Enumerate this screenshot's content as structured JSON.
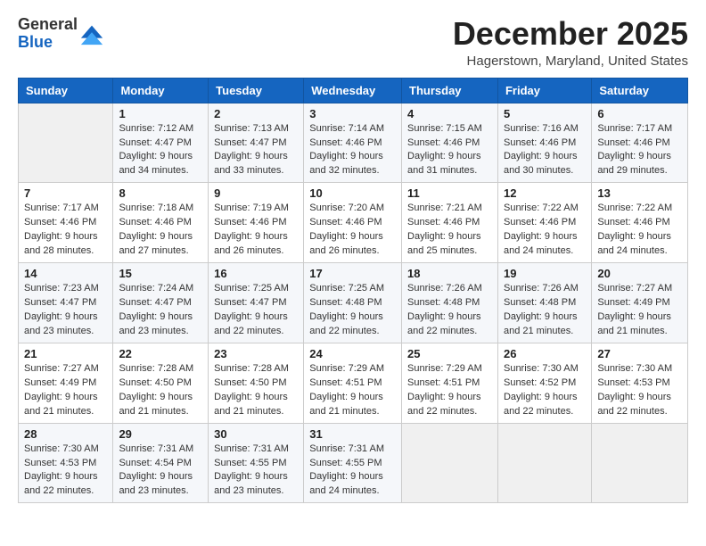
{
  "header": {
    "logo_general": "General",
    "logo_blue": "Blue",
    "month_title": "December 2025",
    "location": "Hagerstown, Maryland, United States"
  },
  "days_of_week": [
    "Sunday",
    "Monday",
    "Tuesday",
    "Wednesday",
    "Thursday",
    "Friday",
    "Saturday"
  ],
  "weeks": [
    [
      {
        "day": "",
        "sunrise": "",
        "sunset": "",
        "daylight": ""
      },
      {
        "day": "1",
        "sunrise": "Sunrise: 7:12 AM",
        "sunset": "Sunset: 4:47 PM",
        "daylight": "Daylight: 9 hours and 34 minutes."
      },
      {
        "day": "2",
        "sunrise": "Sunrise: 7:13 AM",
        "sunset": "Sunset: 4:47 PM",
        "daylight": "Daylight: 9 hours and 33 minutes."
      },
      {
        "day": "3",
        "sunrise": "Sunrise: 7:14 AM",
        "sunset": "Sunset: 4:46 PM",
        "daylight": "Daylight: 9 hours and 32 minutes."
      },
      {
        "day": "4",
        "sunrise": "Sunrise: 7:15 AM",
        "sunset": "Sunset: 4:46 PM",
        "daylight": "Daylight: 9 hours and 31 minutes."
      },
      {
        "day": "5",
        "sunrise": "Sunrise: 7:16 AM",
        "sunset": "Sunset: 4:46 PM",
        "daylight": "Daylight: 9 hours and 30 minutes."
      },
      {
        "day": "6",
        "sunrise": "Sunrise: 7:17 AM",
        "sunset": "Sunset: 4:46 PM",
        "daylight": "Daylight: 9 hours and 29 minutes."
      }
    ],
    [
      {
        "day": "7",
        "sunrise": "Sunrise: 7:17 AM",
        "sunset": "Sunset: 4:46 PM",
        "daylight": "Daylight: 9 hours and 28 minutes."
      },
      {
        "day": "8",
        "sunrise": "Sunrise: 7:18 AM",
        "sunset": "Sunset: 4:46 PM",
        "daylight": "Daylight: 9 hours and 27 minutes."
      },
      {
        "day": "9",
        "sunrise": "Sunrise: 7:19 AM",
        "sunset": "Sunset: 4:46 PM",
        "daylight": "Daylight: 9 hours and 26 minutes."
      },
      {
        "day": "10",
        "sunrise": "Sunrise: 7:20 AM",
        "sunset": "Sunset: 4:46 PM",
        "daylight": "Daylight: 9 hours and 26 minutes."
      },
      {
        "day": "11",
        "sunrise": "Sunrise: 7:21 AM",
        "sunset": "Sunset: 4:46 PM",
        "daylight": "Daylight: 9 hours and 25 minutes."
      },
      {
        "day": "12",
        "sunrise": "Sunrise: 7:22 AM",
        "sunset": "Sunset: 4:46 PM",
        "daylight": "Daylight: 9 hours and 24 minutes."
      },
      {
        "day": "13",
        "sunrise": "Sunrise: 7:22 AM",
        "sunset": "Sunset: 4:46 PM",
        "daylight": "Daylight: 9 hours and 24 minutes."
      }
    ],
    [
      {
        "day": "14",
        "sunrise": "Sunrise: 7:23 AM",
        "sunset": "Sunset: 4:47 PM",
        "daylight": "Daylight: 9 hours and 23 minutes."
      },
      {
        "day": "15",
        "sunrise": "Sunrise: 7:24 AM",
        "sunset": "Sunset: 4:47 PM",
        "daylight": "Daylight: 9 hours and 23 minutes."
      },
      {
        "day": "16",
        "sunrise": "Sunrise: 7:25 AM",
        "sunset": "Sunset: 4:47 PM",
        "daylight": "Daylight: 9 hours and 22 minutes."
      },
      {
        "day": "17",
        "sunrise": "Sunrise: 7:25 AM",
        "sunset": "Sunset: 4:48 PM",
        "daylight": "Daylight: 9 hours and 22 minutes."
      },
      {
        "day": "18",
        "sunrise": "Sunrise: 7:26 AM",
        "sunset": "Sunset: 4:48 PM",
        "daylight": "Daylight: 9 hours and 22 minutes."
      },
      {
        "day": "19",
        "sunrise": "Sunrise: 7:26 AM",
        "sunset": "Sunset: 4:48 PM",
        "daylight": "Daylight: 9 hours and 21 minutes."
      },
      {
        "day": "20",
        "sunrise": "Sunrise: 7:27 AM",
        "sunset": "Sunset: 4:49 PM",
        "daylight": "Daylight: 9 hours and 21 minutes."
      }
    ],
    [
      {
        "day": "21",
        "sunrise": "Sunrise: 7:27 AM",
        "sunset": "Sunset: 4:49 PM",
        "daylight": "Daylight: 9 hours and 21 minutes."
      },
      {
        "day": "22",
        "sunrise": "Sunrise: 7:28 AM",
        "sunset": "Sunset: 4:50 PM",
        "daylight": "Daylight: 9 hours and 21 minutes."
      },
      {
        "day": "23",
        "sunrise": "Sunrise: 7:28 AM",
        "sunset": "Sunset: 4:50 PM",
        "daylight": "Daylight: 9 hours and 21 minutes."
      },
      {
        "day": "24",
        "sunrise": "Sunrise: 7:29 AM",
        "sunset": "Sunset: 4:51 PM",
        "daylight": "Daylight: 9 hours and 21 minutes."
      },
      {
        "day": "25",
        "sunrise": "Sunrise: 7:29 AM",
        "sunset": "Sunset: 4:51 PM",
        "daylight": "Daylight: 9 hours and 22 minutes."
      },
      {
        "day": "26",
        "sunrise": "Sunrise: 7:30 AM",
        "sunset": "Sunset: 4:52 PM",
        "daylight": "Daylight: 9 hours and 22 minutes."
      },
      {
        "day": "27",
        "sunrise": "Sunrise: 7:30 AM",
        "sunset": "Sunset: 4:53 PM",
        "daylight": "Daylight: 9 hours and 22 minutes."
      }
    ],
    [
      {
        "day": "28",
        "sunrise": "Sunrise: 7:30 AM",
        "sunset": "Sunset: 4:53 PM",
        "daylight": "Daylight: 9 hours and 22 minutes."
      },
      {
        "day": "29",
        "sunrise": "Sunrise: 7:31 AM",
        "sunset": "Sunset: 4:54 PM",
        "daylight": "Daylight: 9 hours and 23 minutes."
      },
      {
        "day": "30",
        "sunrise": "Sunrise: 7:31 AM",
        "sunset": "Sunset: 4:55 PM",
        "daylight": "Daylight: 9 hours and 23 minutes."
      },
      {
        "day": "31",
        "sunrise": "Sunrise: 7:31 AM",
        "sunset": "Sunset: 4:55 PM",
        "daylight": "Daylight: 9 hours and 24 minutes."
      },
      {
        "day": "",
        "sunrise": "",
        "sunset": "",
        "daylight": ""
      },
      {
        "day": "",
        "sunrise": "",
        "sunset": "",
        "daylight": ""
      },
      {
        "day": "",
        "sunrise": "",
        "sunset": "",
        "daylight": ""
      }
    ]
  ]
}
